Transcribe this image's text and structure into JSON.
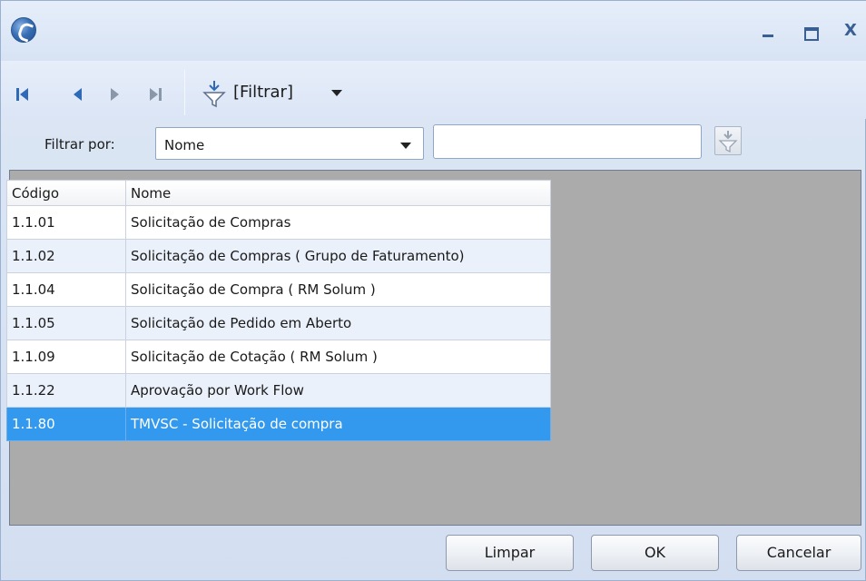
{
  "window": {
    "close_label": "X"
  },
  "toolbar": {
    "filter_label": "[Filtrar]"
  },
  "filter": {
    "label": "Filtrar por:",
    "field_value": "Nome",
    "search_value": ""
  },
  "grid": {
    "columns": [
      "Código",
      "Nome"
    ],
    "rows": [
      {
        "code": "1.1.01",
        "name": "Solicitação de Compras"
      },
      {
        "code": "1.1.02",
        "name": "Solicitação de Compras ( Grupo de Faturamento)"
      },
      {
        "code": "1.1.04",
        "name": "Solicitação de Compra  ( RM Solum )"
      },
      {
        "code": "1.1.05",
        "name": "Solicitação de Pedido em Aberto"
      },
      {
        "code": "1.1.09",
        "name": "Solicitação de Cotação  ( RM Solum )"
      },
      {
        "code": "1.1.22",
        "name": "Aprovação por Work Flow"
      },
      {
        "code": "1.1.80",
        "name": "TMVSC - Solicitação de compra"
      }
    ],
    "selected_index": 6
  },
  "buttons": {
    "clear": "Limpar",
    "ok": "OK",
    "cancel": "Cancelar"
  },
  "icons": {
    "app": "app-logo-icon",
    "first": "first-record-icon",
    "prev": "previous-record-icon",
    "next": "next-record-icon",
    "last": "last-record-icon",
    "filter": "filter-icon"
  }
}
